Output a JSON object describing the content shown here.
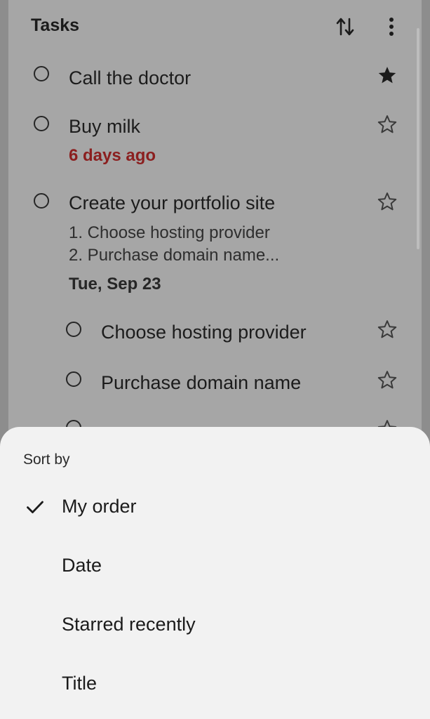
{
  "list": {
    "title": "Tasks",
    "tasks": [
      {
        "title": "Call the doctor",
        "starred": true
      },
      {
        "title": "Buy milk",
        "due": "6 days ago",
        "starred": false
      },
      {
        "title": "Create your portfolio site",
        "notes": [
          "1. Choose hosting provider",
          "2. Purchase domain name..."
        ],
        "due": "Tue, Sep 23",
        "starred": false,
        "subtasks": [
          {
            "title": "Choose hosting provider",
            "starred": false
          },
          {
            "title": "Purchase domain name",
            "starred": false
          }
        ]
      }
    ]
  },
  "icons": {
    "sort": "sort-arrows-icon",
    "more": "more-vert-icon",
    "star_filled": "star-filled-icon",
    "star_outline": "star-outline-icon",
    "check": "checkmark-icon"
  },
  "sheet": {
    "heading": "Sort by",
    "options": [
      {
        "label": "My order",
        "selected": true
      },
      {
        "label": "Date",
        "selected": false
      },
      {
        "label": "Starred recently",
        "selected": false
      },
      {
        "label": "Title",
        "selected": false
      }
    ]
  },
  "colors": {
    "overdue": "#8b1f1f",
    "sheet_bg": "#f2f2f2",
    "scrim_card": "#a6a6a6"
  }
}
